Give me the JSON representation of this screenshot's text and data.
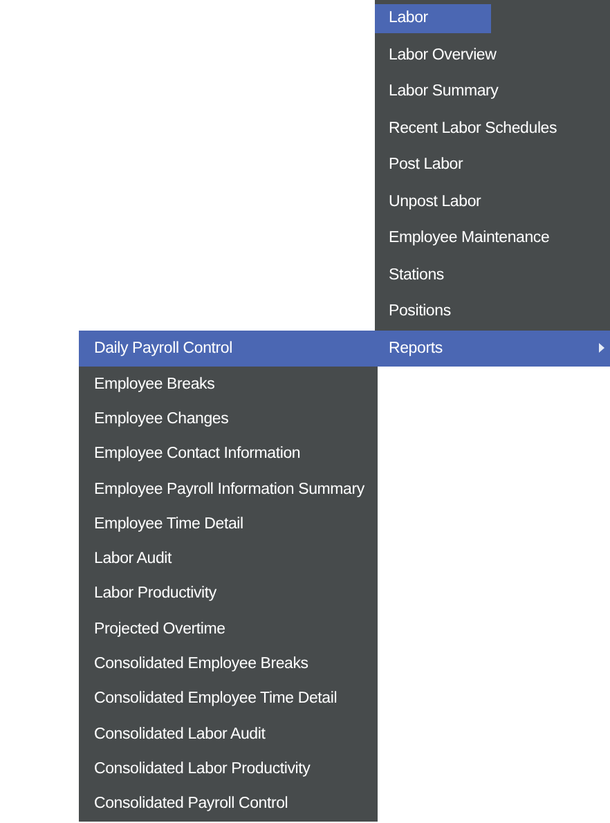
{
  "menu": {
    "title": "Labor",
    "items": [
      {
        "label": "Labor Overview",
        "selected": false,
        "has_submenu": false
      },
      {
        "label": "Labor Summary",
        "selected": false,
        "has_submenu": false
      },
      {
        "label": "Recent Labor Schedules",
        "selected": false,
        "has_submenu": false
      },
      {
        "label": "Post Labor",
        "selected": false,
        "has_submenu": false
      },
      {
        "label": "Unpost Labor",
        "selected": false,
        "has_submenu": false
      },
      {
        "label": "Employee Maintenance",
        "selected": false,
        "has_submenu": false
      },
      {
        "label": "Stations",
        "selected": false,
        "has_submenu": false
      },
      {
        "label": "Positions",
        "selected": false,
        "has_submenu": false
      },
      {
        "label": "Reports",
        "selected": true,
        "has_submenu": true
      }
    ]
  },
  "submenu": {
    "items": [
      {
        "label": "Daily Payroll Control",
        "selected": true
      },
      {
        "label": "Employee Breaks",
        "selected": false
      },
      {
        "label": "Employee Changes",
        "selected": false
      },
      {
        "label": "Employee Contact Information",
        "selected": false
      },
      {
        "label": "Employee Payroll Information Summary",
        "selected": false
      },
      {
        "label": "Employee Time Detail",
        "selected": false
      },
      {
        "label": "Labor Audit",
        "selected": false
      },
      {
        "label": "Labor Productivity",
        "selected": false
      },
      {
        "label": "Projected Overtime",
        "selected": false
      },
      {
        "label": "Consolidated Employee Breaks",
        "selected": false
      },
      {
        "label": "Consolidated Employee Time Detail",
        "selected": false
      },
      {
        "label": "Consolidated Labor Audit",
        "selected": false
      },
      {
        "label": "Consolidated Labor Productivity",
        "selected": false
      },
      {
        "label": "Consolidated Payroll Control",
        "selected": false
      }
    ]
  }
}
